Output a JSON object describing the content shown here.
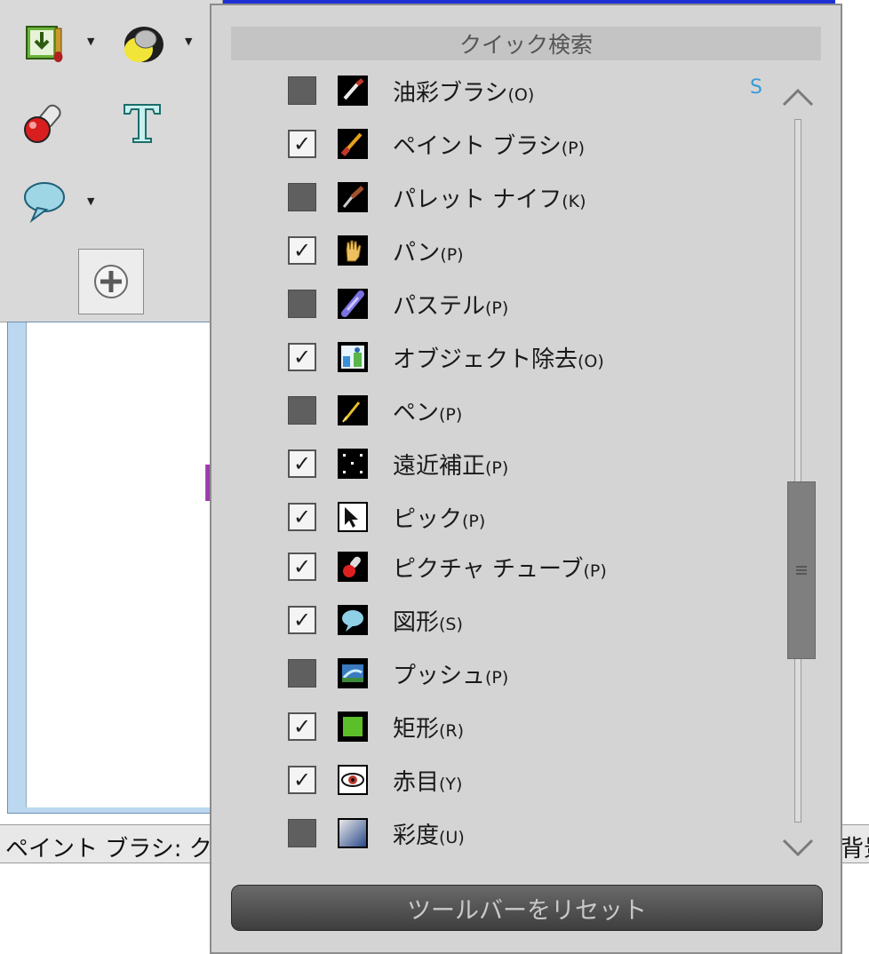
{
  "app": {
    "status_text": "ペイント ブラシ: クリッ",
    "status_right_text": "背景",
    "canvas_mark_text": "M"
  },
  "popup": {
    "header": "クイック検索",
    "s_indicator": "S",
    "reset_button_label": "ツールバーをリセット",
    "items": [
      {
        "name": "油彩ブラシ",
        "key": "(O)",
        "checked": false,
        "icon": "oil-brush-icon"
      },
      {
        "name": "ペイント ブラシ",
        "key": "(P)",
        "checked": true,
        "icon": "paint-brush-icon"
      },
      {
        "name": "パレット ナイフ",
        "key": "(K)",
        "checked": false,
        "icon": "palette-knife-icon"
      },
      {
        "name": "パン",
        "key": "(P)",
        "checked": true,
        "icon": "pan-hand-icon"
      },
      {
        "name": "パステル",
        "key": "(P)",
        "checked": false,
        "icon": "pastel-icon"
      },
      {
        "name": "オブジェクト除去",
        "key": "(O)",
        "checked": true,
        "icon": "object-removal-icon"
      },
      {
        "name": "ペン",
        "key": "(P)",
        "checked": false,
        "icon": "pen-icon"
      },
      {
        "name": "遠近補正",
        "key": "(P)",
        "checked": true,
        "icon": "perspective-icon"
      },
      {
        "name": "ピック",
        "key": "(P)",
        "checked": true,
        "icon": "pick-arrow-icon"
      },
      {
        "name": "ピクチャ チューブ",
        "key": "(P)",
        "checked": true,
        "icon": "picture-tube-icon"
      },
      {
        "name": "図形",
        "key": "(S)",
        "checked": true,
        "icon": "shape-bubble-icon"
      },
      {
        "name": "プッシュ",
        "key": "(P)",
        "checked": false,
        "icon": "push-icon"
      },
      {
        "name": "矩形",
        "key": "(R)",
        "checked": true,
        "icon": "rectangle-icon"
      },
      {
        "name": "赤目",
        "key": "(Y)",
        "checked": true,
        "icon": "red-eye-icon"
      },
      {
        "name": "彩度",
        "key": "(U)",
        "checked": false,
        "icon": "saturation-icon"
      }
    ]
  },
  "colors": {
    "popup_bg": "#d4d4d4",
    "reset_button": "#4a4a4a",
    "canvas_frame": "#bcd8f0",
    "accent_blue": "#1f2fd6"
  }
}
